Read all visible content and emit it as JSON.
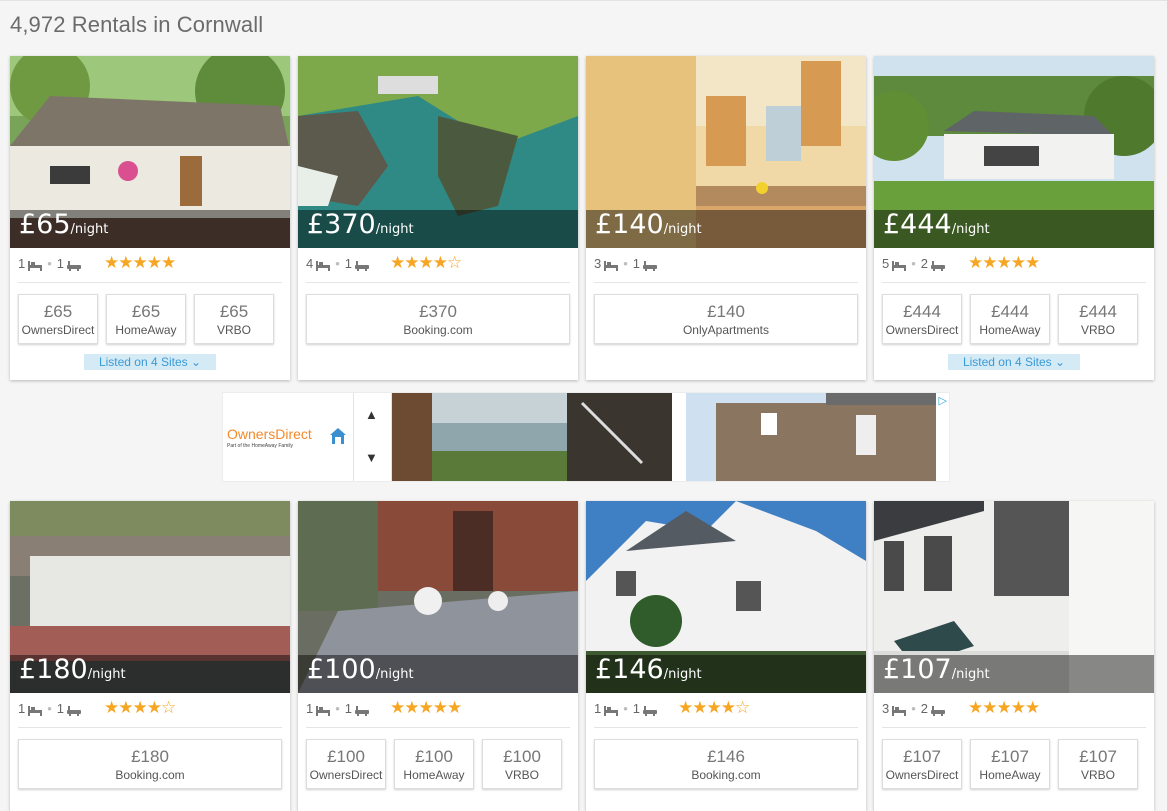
{
  "page": {
    "heading": "4,972 Rentals in Cornwall"
  },
  "listings_row1": [
    {
      "price": "£65",
      "per": "/night",
      "beds": "1",
      "baths": "1",
      "stars": "★★★★★",
      "offers": [
        {
          "price": "£65",
          "site": "OwnersDirect"
        },
        {
          "price": "£65",
          "site": "HomeAway"
        },
        {
          "price": "£65",
          "site": "VRBO"
        }
      ],
      "listed": "Listed on 4 Sites ⌄"
    },
    {
      "price": "£370",
      "per": "/night",
      "beds": "4",
      "baths": "1",
      "stars": "★★★★☆",
      "offers": [
        {
          "price": "£370",
          "site": "Booking.com"
        }
      ]
    },
    {
      "price": "£140",
      "per": "/night",
      "beds": "3",
      "baths": "1",
      "stars": "",
      "offers": [
        {
          "price": "£140",
          "site": "OnlyApartments"
        }
      ]
    },
    {
      "price": "£444",
      "per": "/night",
      "beds": "5",
      "baths": "2",
      "stars": "★★★★★",
      "offers": [
        {
          "price": "£444",
          "site": "OwnersDirect"
        },
        {
          "price": "£444",
          "site": "HomeAway"
        },
        {
          "price": "£444",
          "site": "VRBO"
        }
      ],
      "listed": "Listed on 4 Sites ⌄"
    }
  ],
  "listings_row2": [
    {
      "price": "£180",
      "per": "/night",
      "beds": "1",
      "baths": "1",
      "stars": "★★★★☆",
      "offers": [
        {
          "price": "£180",
          "site": "Booking.com"
        }
      ]
    },
    {
      "price": "£100",
      "per": "/night",
      "beds": "1",
      "baths": "1",
      "stars": "★★★★★",
      "offers": [
        {
          "price": "£100",
          "site": "OwnersDirect"
        },
        {
          "price": "£100",
          "site": "HomeAway"
        },
        {
          "price": "£100",
          "site": "VRBO"
        }
      ]
    },
    {
      "price": "£146",
      "per": "/night",
      "beds": "1",
      "baths": "1",
      "stars": "★★★★☆",
      "offers": [
        {
          "price": "£146",
          "site": "Booking.com"
        }
      ]
    },
    {
      "price": "£107",
      "per": "/night",
      "beds": "3",
      "baths": "2",
      "stars": "★★★★★",
      "offers": [
        {
          "price": "£107",
          "site": "OwnersDirect"
        },
        {
          "price": "£107",
          "site": "HomeAway"
        },
        {
          "price": "£107",
          "site": "VRBO"
        }
      ]
    }
  ],
  "ad": {
    "brand": "OwnersDirect",
    "tagline": "Part of the HomeAway Family",
    "up": "▲",
    "down": "▼",
    "choices": "▷"
  },
  "colors": {
    "accent_star": "#f6a623",
    "link": "#3a9ad6",
    "listed_bg": "#d4eaf5",
    "brand_orange": "#f28a2a"
  },
  "icons": [
    "bed-icon",
    "bath-icon",
    "house-logo-icon",
    "ad-choices-icon"
  ]
}
